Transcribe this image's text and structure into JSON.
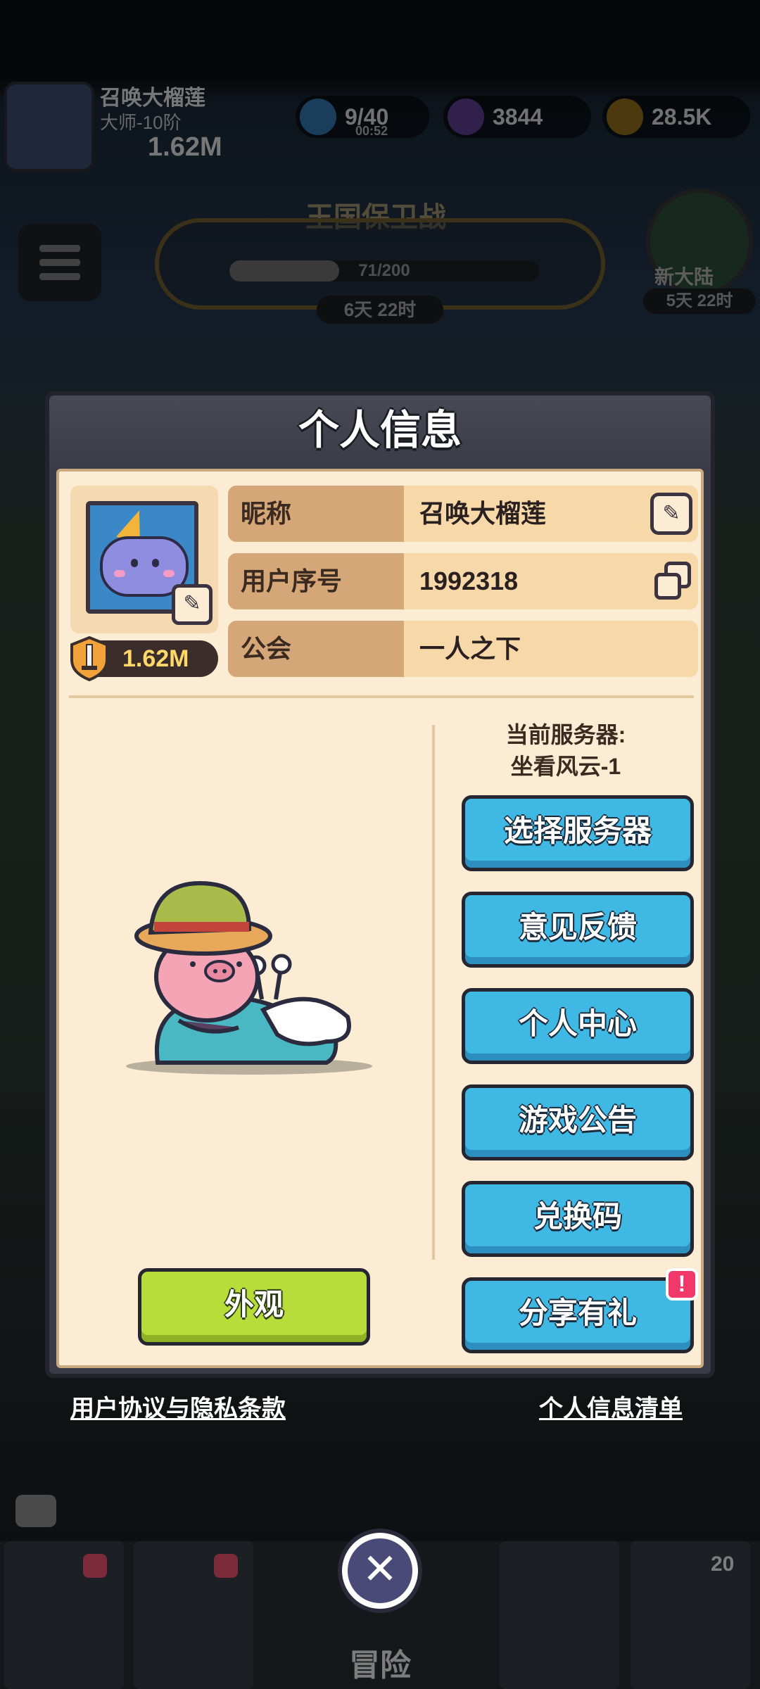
{
  "hud": {
    "player_name": "召唤大榴莲",
    "rank": "大师-10阶",
    "power": "1.62M",
    "energy": "9/40",
    "energy_timer": "00:52",
    "gems": "3844",
    "gold": "28.5K"
  },
  "event": {
    "title": "王国保卫战",
    "progress": "71/200",
    "time_left": "6天 22时",
    "new_land_label": "新大陆",
    "new_land_time": "5天 22时"
  },
  "modal": {
    "title": "个人信息",
    "power": "1.62M",
    "rows": [
      {
        "label": "昵称",
        "value": "召唤大榴莲"
      },
      {
        "label": "用户序号",
        "value": "1992318"
      },
      {
        "label": "公会",
        "value": "一人之下"
      }
    ],
    "server_title": "当前服务器:",
    "server_name": "坐看风云-1",
    "buttons": {
      "select_server": "选择服务器",
      "feedback": "意见反馈",
      "personal_center": "个人中心",
      "announcements": "游戏公告",
      "redeem_code": "兑换码",
      "share_reward": "分享有礼",
      "appearance": "外观"
    },
    "alert_mark": "!"
  },
  "footer": {
    "agreement": "用户协议与隐私条款",
    "info_list": "个人信息清单"
  },
  "bottom_nav": {
    "center_label": "冒险",
    "badge_count": "20"
  },
  "icons": {
    "close": "close-icon",
    "edit": "edit-icon",
    "copy": "copy-icon",
    "power": "sword-shield-icon"
  },
  "colors": {
    "panel_bg": "#fbecd3",
    "blue_button": "#3fb8e4",
    "green_button": "#b8dd3a",
    "label_bg": "#d4a678",
    "alert": "#f0386a"
  }
}
